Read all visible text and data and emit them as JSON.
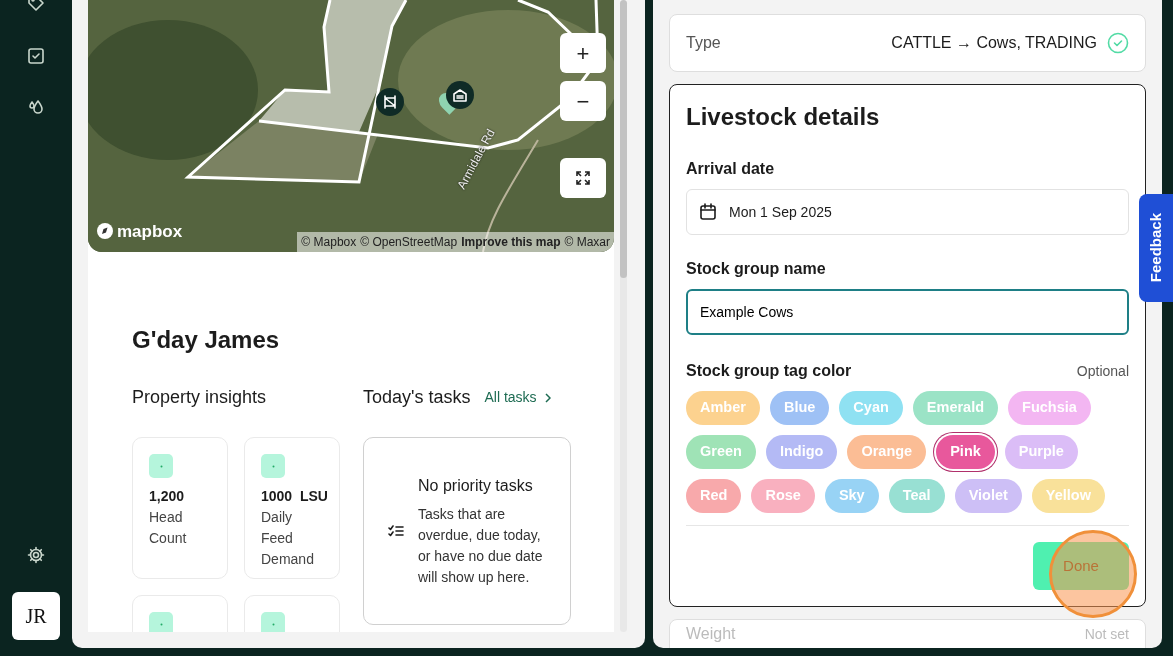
{
  "sidebar": {
    "avatar_initials": "JR"
  },
  "map": {
    "road_label": "Armidale Rd",
    "logo_text": "mapbox",
    "attribution": [
      "© Mapbox",
      "© OpenStreetMap"
    ],
    "improve_link": "Improve this map",
    "imagery_credit": "© Maxar",
    "zoom_in": "+",
    "zoom_out": "−"
  },
  "greeting": "G'day James",
  "insights": {
    "title": "Property insights",
    "cards": [
      {
        "kind": "stat",
        "value": "1,200",
        "label": "Head Count"
      },
      {
        "kind": "stat",
        "value": "1000",
        "unit": "LSU",
        "label": "Daily Feed Demand"
      },
      {
        "kind": "partial"
      },
      {
        "kind": "partial"
      }
    ]
  },
  "tasks": {
    "title": "Today's tasks",
    "link": "All tasks",
    "empty_title": "No priority tasks",
    "empty_text": "Tasks that are overdue, due today, or have no due date will show up here."
  },
  "type_row": {
    "label": "Type",
    "value": "CATTLE → Cows, TRADING",
    "confirmed": true
  },
  "details": {
    "title": "Livestock details",
    "arrival_label": "Arrival date",
    "arrival_value": "Mon 1 Sep 2025",
    "name_label": "Stock group name",
    "name_value": "Example Cows",
    "name_focused": true,
    "tag_label": "Stock group tag color",
    "tag_hint": "Optional",
    "tags": [
      {
        "label": "Amber",
        "color": "#fcd28f",
        "selected": false
      },
      {
        "label": "Blue",
        "color": "#9ec1f5",
        "selected": false
      },
      {
        "label": "Cyan",
        "color": "#8fe1f2",
        "selected": false
      },
      {
        "label": "Emerald",
        "color": "#9be3c6",
        "selected": false
      },
      {
        "label": "Fuchsia",
        "color": "#f3b6f2",
        "selected": false
      },
      {
        "label": "Green",
        "color": "#9fe3b6",
        "selected": false
      },
      {
        "label": "Indigo",
        "color": "#b4baf5",
        "selected": false
      },
      {
        "label": "Orange",
        "color": "#fbbd95",
        "selected": false
      },
      {
        "label": "Pink",
        "color": "#e8589c",
        "selected": true
      },
      {
        "label": "Purple",
        "color": "#dbbdf7",
        "selected": false
      },
      {
        "label": "Red",
        "color": "#f8a9ab",
        "selected": false
      },
      {
        "label": "Rose",
        "color": "#f9b0bf",
        "selected": false
      },
      {
        "label": "Sky",
        "color": "#98d3f5",
        "selected": false
      },
      {
        "label": "Teal",
        "color": "#98e0d3",
        "selected": false
      },
      {
        "label": "Violet",
        "color": "#cdbff6",
        "selected": false
      },
      {
        "label": "Yellow",
        "color": "#f9e19a",
        "selected": false
      }
    ],
    "done": "Done"
  },
  "weight_row": {
    "label": "Weight",
    "value": "Not set"
  },
  "feedback": "Feedback"
}
